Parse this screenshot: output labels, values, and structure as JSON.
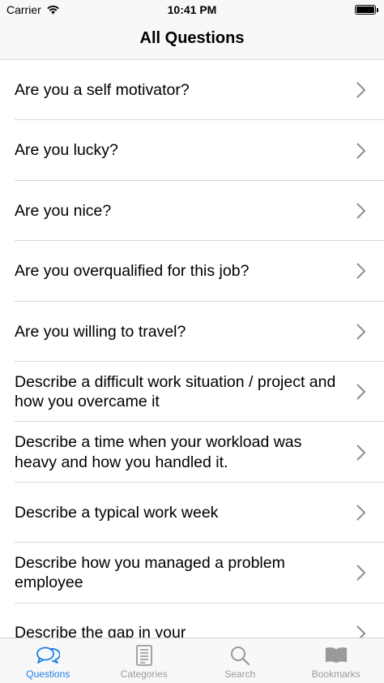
{
  "status": {
    "carrier": "Carrier",
    "time": "10:41 PM"
  },
  "nav": {
    "title": "All Questions"
  },
  "questions": [
    "Are you a self motivator?",
    "Are you lucky?",
    "Are you nice?",
    "Are you overqualified for this job?",
    "Are you willing to travel?",
    "Describe a difficult work situation / project and how you overcame it",
    "Describe a time when your workload was heavy and how you handled it.",
    "Describe a typical work week",
    "Describe how you managed a problem employee",
    "Describe the gap in your"
  ],
  "tabs": [
    {
      "label": "Questions",
      "icon": "chat-bubbles-icon",
      "active": true
    },
    {
      "label": "Categories",
      "icon": "document-icon",
      "active": false
    },
    {
      "label": "Search",
      "icon": "search-icon",
      "active": false
    },
    {
      "label": "Bookmarks",
      "icon": "book-icon",
      "active": false
    }
  ],
  "colors": {
    "accent": "#1a7ee6",
    "inactive": "#9a9a9a"
  }
}
